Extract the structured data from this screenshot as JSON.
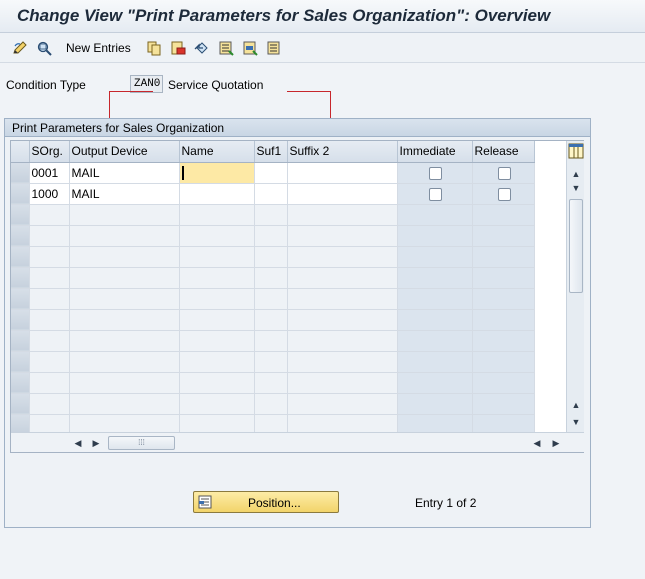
{
  "window": {
    "title": "Change View \"Print Parameters for Sales Organization\": Overview"
  },
  "toolbar": {
    "icons": [
      "edit-pencil-icon",
      "display-glasses-icon",
      "copy-icon",
      "delete-icon",
      "undo-icon",
      "select-all-icon",
      "select-block-icon",
      "deselect-all-icon"
    ],
    "new_entries_label": "New Entries"
  },
  "condition": {
    "label": "Condition Type",
    "value": "ZAN0",
    "description": "Service Quotation"
  },
  "group": {
    "title": "Print Parameters for Sales Organization"
  },
  "table": {
    "columns": [
      "SOrg.",
      "Output Device",
      "Name",
      "Suf1",
      "Suffix 2",
      "Immediate",
      "Release"
    ],
    "rows": [
      {
        "sorg": "0001",
        "device": "MAIL",
        "name": "",
        "suf1": "",
        "suffix2": "",
        "immediate": false,
        "release": false
      },
      {
        "sorg": "1000",
        "device": "MAIL",
        "name": "",
        "suf1": "",
        "suffix2": "",
        "immediate": false,
        "release": false
      }
    ]
  },
  "footer": {
    "position_button": "Position...",
    "entry_info": "Entry 1 of 2"
  },
  "colors": {
    "annotation_red": "#c7262c",
    "focus_yellow": "#fde9a5",
    "button_yellow": "#f2d46a"
  }
}
